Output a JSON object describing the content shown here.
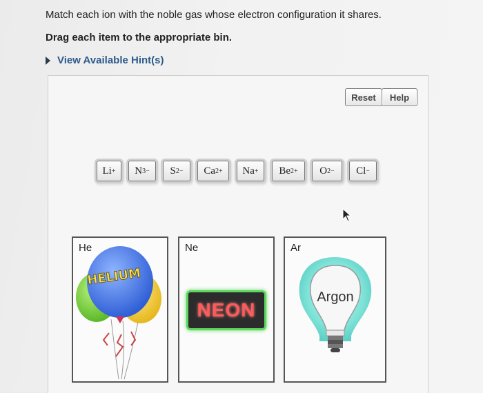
{
  "question": {
    "line1": "Match each ion with the noble gas whose electron configuration it shares.",
    "line2": "Drag each item to the appropriate bin."
  },
  "hint": {
    "label": "View Available Hint(s)"
  },
  "toolbar": {
    "reset_label": "Reset",
    "help_label": "Help"
  },
  "ions": [
    {
      "symbol": "Li",
      "charge": "+"
    },
    {
      "symbol": "N",
      "charge": "3−"
    },
    {
      "symbol": "S",
      "charge": "2−"
    },
    {
      "symbol": "Ca",
      "charge": "2+"
    },
    {
      "symbol": "Na",
      "charge": "+"
    },
    {
      "symbol": "Be",
      "charge": "2+"
    },
    {
      "symbol": "O",
      "charge": "2−"
    },
    {
      "symbol": "Cl",
      "charge": "−"
    }
  ],
  "bins": [
    {
      "label": "He",
      "image_text": "HELIUM"
    },
    {
      "label": "Ne",
      "image_text": "NEON"
    },
    {
      "label": "Ar",
      "image_text": "Argon"
    }
  ],
  "colors": {
    "hint_link": "#2d5a8c",
    "neon_text": "#ff5a5a",
    "neon_border": "#5cd65c"
  }
}
